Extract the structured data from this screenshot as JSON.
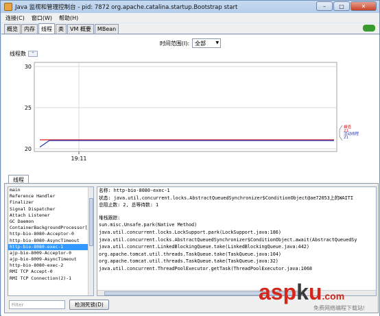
{
  "window": {
    "title": "Java 监视和管理控制台 - pid: 7872 org.apache.catalina.startup.Bootstrap start",
    "controls": {
      "minimize": "–",
      "maximize": "□",
      "close": "✕"
    }
  },
  "menu": [
    "连接(C)",
    "窗口(W)",
    "帮助(H)"
  ],
  "tabs": [
    {
      "label": "概览",
      "active": false
    },
    {
      "label": "内存",
      "active": false
    },
    {
      "label": "线程",
      "active": true
    },
    {
      "label": "类",
      "active": false
    },
    {
      "label": "VM 概要",
      "active": false
    },
    {
      "label": "MBean",
      "active": false
    }
  ],
  "time_range": {
    "label": "时间范围(I):",
    "value": "全部"
  },
  "chart": {
    "title": "线程数",
    "collapse_symbol": "⌃"
  },
  "chart_data": {
    "type": "line",
    "title": "线程数",
    "ylim": [
      20,
      30
    ],
    "y_ticks": [
      20,
      25,
      30
    ],
    "x_ticks": [
      "19:11"
    ],
    "series": [
      {
        "name": "峰值",
        "value_label": "21",
        "color": "#d9191f",
        "values": [
          21,
          21,
          21,
          21,
          21,
          21
        ]
      },
      {
        "name": "活动线程",
        "value_label": "21",
        "color": "#2035b8",
        "values": [
          20.2,
          21,
          21,
          21,
          21,
          21
        ]
      }
    ],
    "grid": true
  },
  "threads": {
    "tab_label": "线程",
    "list": [
      "main",
      "Reference Handler",
      "Finalizer",
      "Signal Dispatcher",
      "Attach Listener",
      "GC Daemon",
      "ContainerBackgroundProcessor[S",
      "http-bio-8080-Acceptor-0",
      "http-bio-8080-AsyncTimeout",
      "http-bio-8080-exec-1",
      "ajp-bio-8009-Acceptor-0",
      "ajp-bio-8009-AsyncTimeout",
      "http-bio-8080-exec-2",
      "RMI TCP Accept-0",
      "RMI TCP Connection(2)-1"
    ],
    "selected_index": 9,
    "detail": [
      "名称: http-bio-8080-exec-1",
      "状态: java.util.concurrent.locks.AbstractQueuedSynchronizer$ConditionObject@ae72053上的WAITI",
      "总阻止数: 2, 总等待数: 1",
      "",
      "堆栈跟踪:",
      "sun.misc.Unsafe.park(Native Method)",
      "java.util.concurrent.locks.LockSupport.park(LockSupport.java:186)",
      "java.util.concurrent.locks.AbstractQueuedSynchronizer$ConditionObject.await(AbstractQueuedSy",
      "java.util.concurrent.LinkedBlockingQueue.take(LinkedBlockingQueue.java:442)",
      "org.apache.tomcat.util.threads.TaskQueue.take(TaskQueue.java:104)",
      "org.apache.tomcat.util.threads.TaskQueue.take(TaskQueue.java:32)",
      "java.util.concurrent.ThreadPoolExecutor.getTask(ThreadPoolExecutor.java:1068"
    ],
    "filter_placeholder": "Filter",
    "detect_button": "检测死锁(D)"
  },
  "watermark": {
    "main": "asp",
    "dot": "k",
    "main2": "u",
    "tld": ".com",
    "sub": "免费网络编程下载站!"
  }
}
